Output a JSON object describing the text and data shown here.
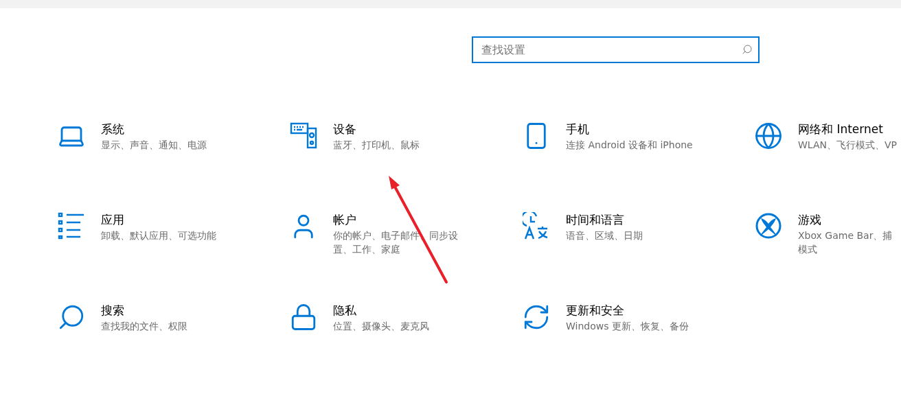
{
  "search": {
    "placeholder": "查找设置"
  },
  "categories": [
    {
      "kind": "system",
      "title": "系统",
      "lines": [
        "显示、声音、通知、电源"
      ]
    },
    {
      "kind": "devices",
      "title": "设备",
      "lines": [
        "蓝牙、打印机、鼠标"
      ]
    },
    {
      "kind": "phone",
      "title": "手机",
      "lines": [
        "连接 Android 设备和 iPhone"
      ]
    },
    {
      "kind": "network",
      "title": "网络和 Internet",
      "lines": [
        "WLAN、飞行模式、VP"
      ]
    },
    {
      "kind": "apps",
      "title": "应用",
      "lines": [
        "卸载、默认应用、可选功能"
      ]
    },
    {
      "kind": "accounts",
      "title": "帐户",
      "lines": [
        "你的帐户、电子邮件、同步设",
        "置、工作、家庭"
      ]
    },
    {
      "kind": "time",
      "title": "时间和语言",
      "lines": [
        "语音、区域、日期"
      ]
    },
    {
      "kind": "gaming",
      "title": "游戏",
      "lines": [
        "Xbox Game Bar、捕",
        "模式"
      ]
    },
    {
      "kind": "search",
      "title": "搜索",
      "lines": [
        "查找我的文件、权限"
      ]
    },
    {
      "kind": "privacy",
      "title": "隐私",
      "lines": [
        "位置、摄像头、麦克风"
      ]
    },
    {
      "kind": "update",
      "title": "更新和安全",
      "lines": [
        "Windows 更新、恢复、备份"
      ]
    }
  ]
}
